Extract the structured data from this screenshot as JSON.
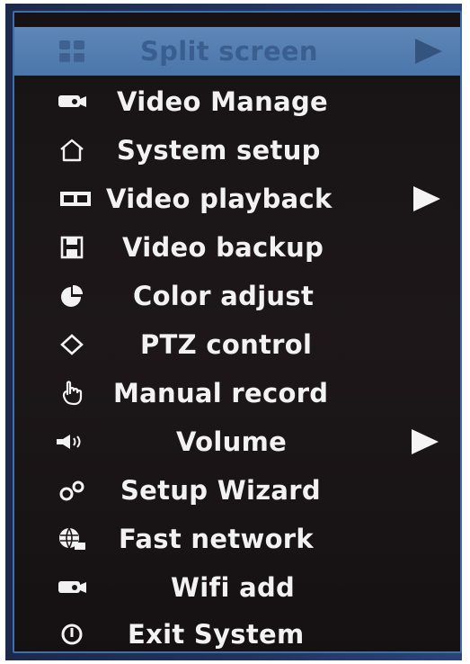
{
  "menu": {
    "items": [
      {
        "label": "Split screen",
        "icon": "grid-icon",
        "submenu": true,
        "selected": true
      },
      {
        "label": "Video Manage",
        "icon": "camera-icon",
        "submenu": false
      },
      {
        "label": "System setup",
        "icon": "house-icon",
        "submenu": false
      },
      {
        "label": "Video playback",
        "icon": "film-icon",
        "submenu": true
      },
      {
        "label": "Video backup",
        "icon": "floppy-disk-icon",
        "submenu": false
      },
      {
        "label": "Color adjust",
        "icon": "pie-chart-icon",
        "submenu": false
      },
      {
        "label": "PTZ control",
        "icon": "diamond-icon",
        "submenu": false
      },
      {
        "label": "Manual record",
        "icon": "hand-pointer-icon",
        "submenu": false
      },
      {
        "label": "Volume",
        "icon": "speaker-icon",
        "submenu": true
      },
      {
        "label": "Setup Wizard",
        "icon": "wizard-icon",
        "submenu": false
      },
      {
        "label": "Fast network",
        "icon": "globe-network-icon",
        "submenu": false
      },
      {
        "label": "Wifi add",
        "icon": "camera-icon",
        "submenu": false
      },
      {
        "label": "Exit System",
        "icon": "power-icon",
        "submenu": false
      }
    ]
  },
  "colors": {
    "menu_background": "#1a1517",
    "selected_background": "#4f7aae",
    "text": "#f2f2f2",
    "border": "#3f6ea8"
  }
}
